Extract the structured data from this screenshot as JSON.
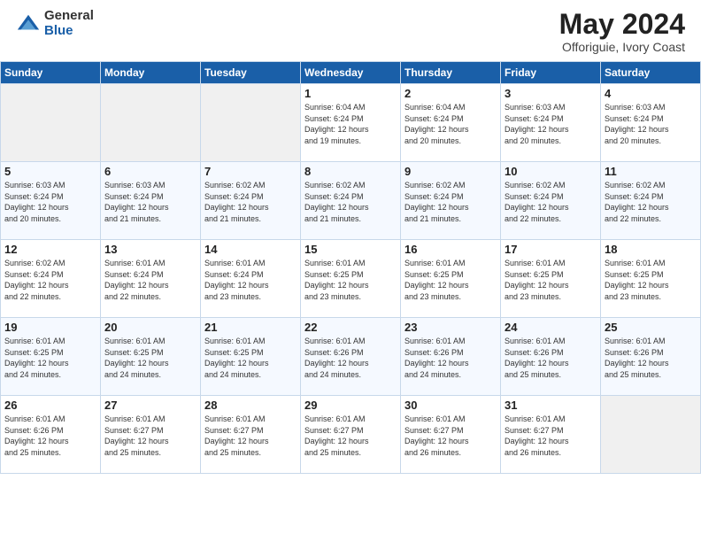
{
  "logo": {
    "general": "General",
    "blue": "Blue"
  },
  "title": {
    "month_year": "May 2024",
    "location": "Offoriguie, Ivory Coast"
  },
  "days_of_week": [
    "Sunday",
    "Monday",
    "Tuesday",
    "Wednesday",
    "Thursday",
    "Friday",
    "Saturday"
  ],
  "weeks": [
    [
      {
        "day": "",
        "info": ""
      },
      {
        "day": "",
        "info": ""
      },
      {
        "day": "",
        "info": ""
      },
      {
        "day": "1",
        "info": "Sunrise: 6:04 AM\nSunset: 6:24 PM\nDaylight: 12 hours\nand 19 minutes."
      },
      {
        "day": "2",
        "info": "Sunrise: 6:04 AM\nSunset: 6:24 PM\nDaylight: 12 hours\nand 20 minutes."
      },
      {
        "day": "3",
        "info": "Sunrise: 6:03 AM\nSunset: 6:24 PM\nDaylight: 12 hours\nand 20 minutes."
      },
      {
        "day": "4",
        "info": "Sunrise: 6:03 AM\nSunset: 6:24 PM\nDaylight: 12 hours\nand 20 minutes."
      }
    ],
    [
      {
        "day": "5",
        "info": "Sunrise: 6:03 AM\nSunset: 6:24 PM\nDaylight: 12 hours\nand 20 minutes."
      },
      {
        "day": "6",
        "info": "Sunrise: 6:03 AM\nSunset: 6:24 PM\nDaylight: 12 hours\nand 21 minutes."
      },
      {
        "day": "7",
        "info": "Sunrise: 6:02 AM\nSunset: 6:24 PM\nDaylight: 12 hours\nand 21 minutes."
      },
      {
        "day": "8",
        "info": "Sunrise: 6:02 AM\nSunset: 6:24 PM\nDaylight: 12 hours\nand 21 minutes."
      },
      {
        "day": "9",
        "info": "Sunrise: 6:02 AM\nSunset: 6:24 PM\nDaylight: 12 hours\nand 21 minutes."
      },
      {
        "day": "10",
        "info": "Sunrise: 6:02 AM\nSunset: 6:24 PM\nDaylight: 12 hours\nand 22 minutes."
      },
      {
        "day": "11",
        "info": "Sunrise: 6:02 AM\nSunset: 6:24 PM\nDaylight: 12 hours\nand 22 minutes."
      }
    ],
    [
      {
        "day": "12",
        "info": "Sunrise: 6:02 AM\nSunset: 6:24 PM\nDaylight: 12 hours\nand 22 minutes."
      },
      {
        "day": "13",
        "info": "Sunrise: 6:01 AM\nSunset: 6:24 PM\nDaylight: 12 hours\nand 22 minutes."
      },
      {
        "day": "14",
        "info": "Sunrise: 6:01 AM\nSunset: 6:24 PM\nDaylight: 12 hours\nand 23 minutes."
      },
      {
        "day": "15",
        "info": "Sunrise: 6:01 AM\nSunset: 6:25 PM\nDaylight: 12 hours\nand 23 minutes."
      },
      {
        "day": "16",
        "info": "Sunrise: 6:01 AM\nSunset: 6:25 PM\nDaylight: 12 hours\nand 23 minutes."
      },
      {
        "day": "17",
        "info": "Sunrise: 6:01 AM\nSunset: 6:25 PM\nDaylight: 12 hours\nand 23 minutes."
      },
      {
        "day": "18",
        "info": "Sunrise: 6:01 AM\nSunset: 6:25 PM\nDaylight: 12 hours\nand 23 minutes."
      }
    ],
    [
      {
        "day": "19",
        "info": "Sunrise: 6:01 AM\nSunset: 6:25 PM\nDaylight: 12 hours\nand 24 minutes."
      },
      {
        "day": "20",
        "info": "Sunrise: 6:01 AM\nSunset: 6:25 PM\nDaylight: 12 hours\nand 24 minutes."
      },
      {
        "day": "21",
        "info": "Sunrise: 6:01 AM\nSunset: 6:25 PM\nDaylight: 12 hours\nand 24 minutes."
      },
      {
        "day": "22",
        "info": "Sunrise: 6:01 AM\nSunset: 6:26 PM\nDaylight: 12 hours\nand 24 minutes."
      },
      {
        "day": "23",
        "info": "Sunrise: 6:01 AM\nSunset: 6:26 PM\nDaylight: 12 hours\nand 24 minutes."
      },
      {
        "day": "24",
        "info": "Sunrise: 6:01 AM\nSunset: 6:26 PM\nDaylight: 12 hours\nand 25 minutes."
      },
      {
        "day": "25",
        "info": "Sunrise: 6:01 AM\nSunset: 6:26 PM\nDaylight: 12 hours\nand 25 minutes."
      }
    ],
    [
      {
        "day": "26",
        "info": "Sunrise: 6:01 AM\nSunset: 6:26 PM\nDaylight: 12 hours\nand 25 minutes."
      },
      {
        "day": "27",
        "info": "Sunrise: 6:01 AM\nSunset: 6:27 PM\nDaylight: 12 hours\nand 25 minutes."
      },
      {
        "day": "28",
        "info": "Sunrise: 6:01 AM\nSunset: 6:27 PM\nDaylight: 12 hours\nand 25 minutes."
      },
      {
        "day": "29",
        "info": "Sunrise: 6:01 AM\nSunset: 6:27 PM\nDaylight: 12 hours\nand 25 minutes."
      },
      {
        "day": "30",
        "info": "Sunrise: 6:01 AM\nSunset: 6:27 PM\nDaylight: 12 hours\nand 26 minutes."
      },
      {
        "day": "31",
        "info": "Sunrise: 6:01 AM\nSunset: 6:27 PM\nDaylight: 12 hours\nand 26 minutes."
      },
      {
        "day": "",
        "info": ""
      }
    ]
  ]
}
